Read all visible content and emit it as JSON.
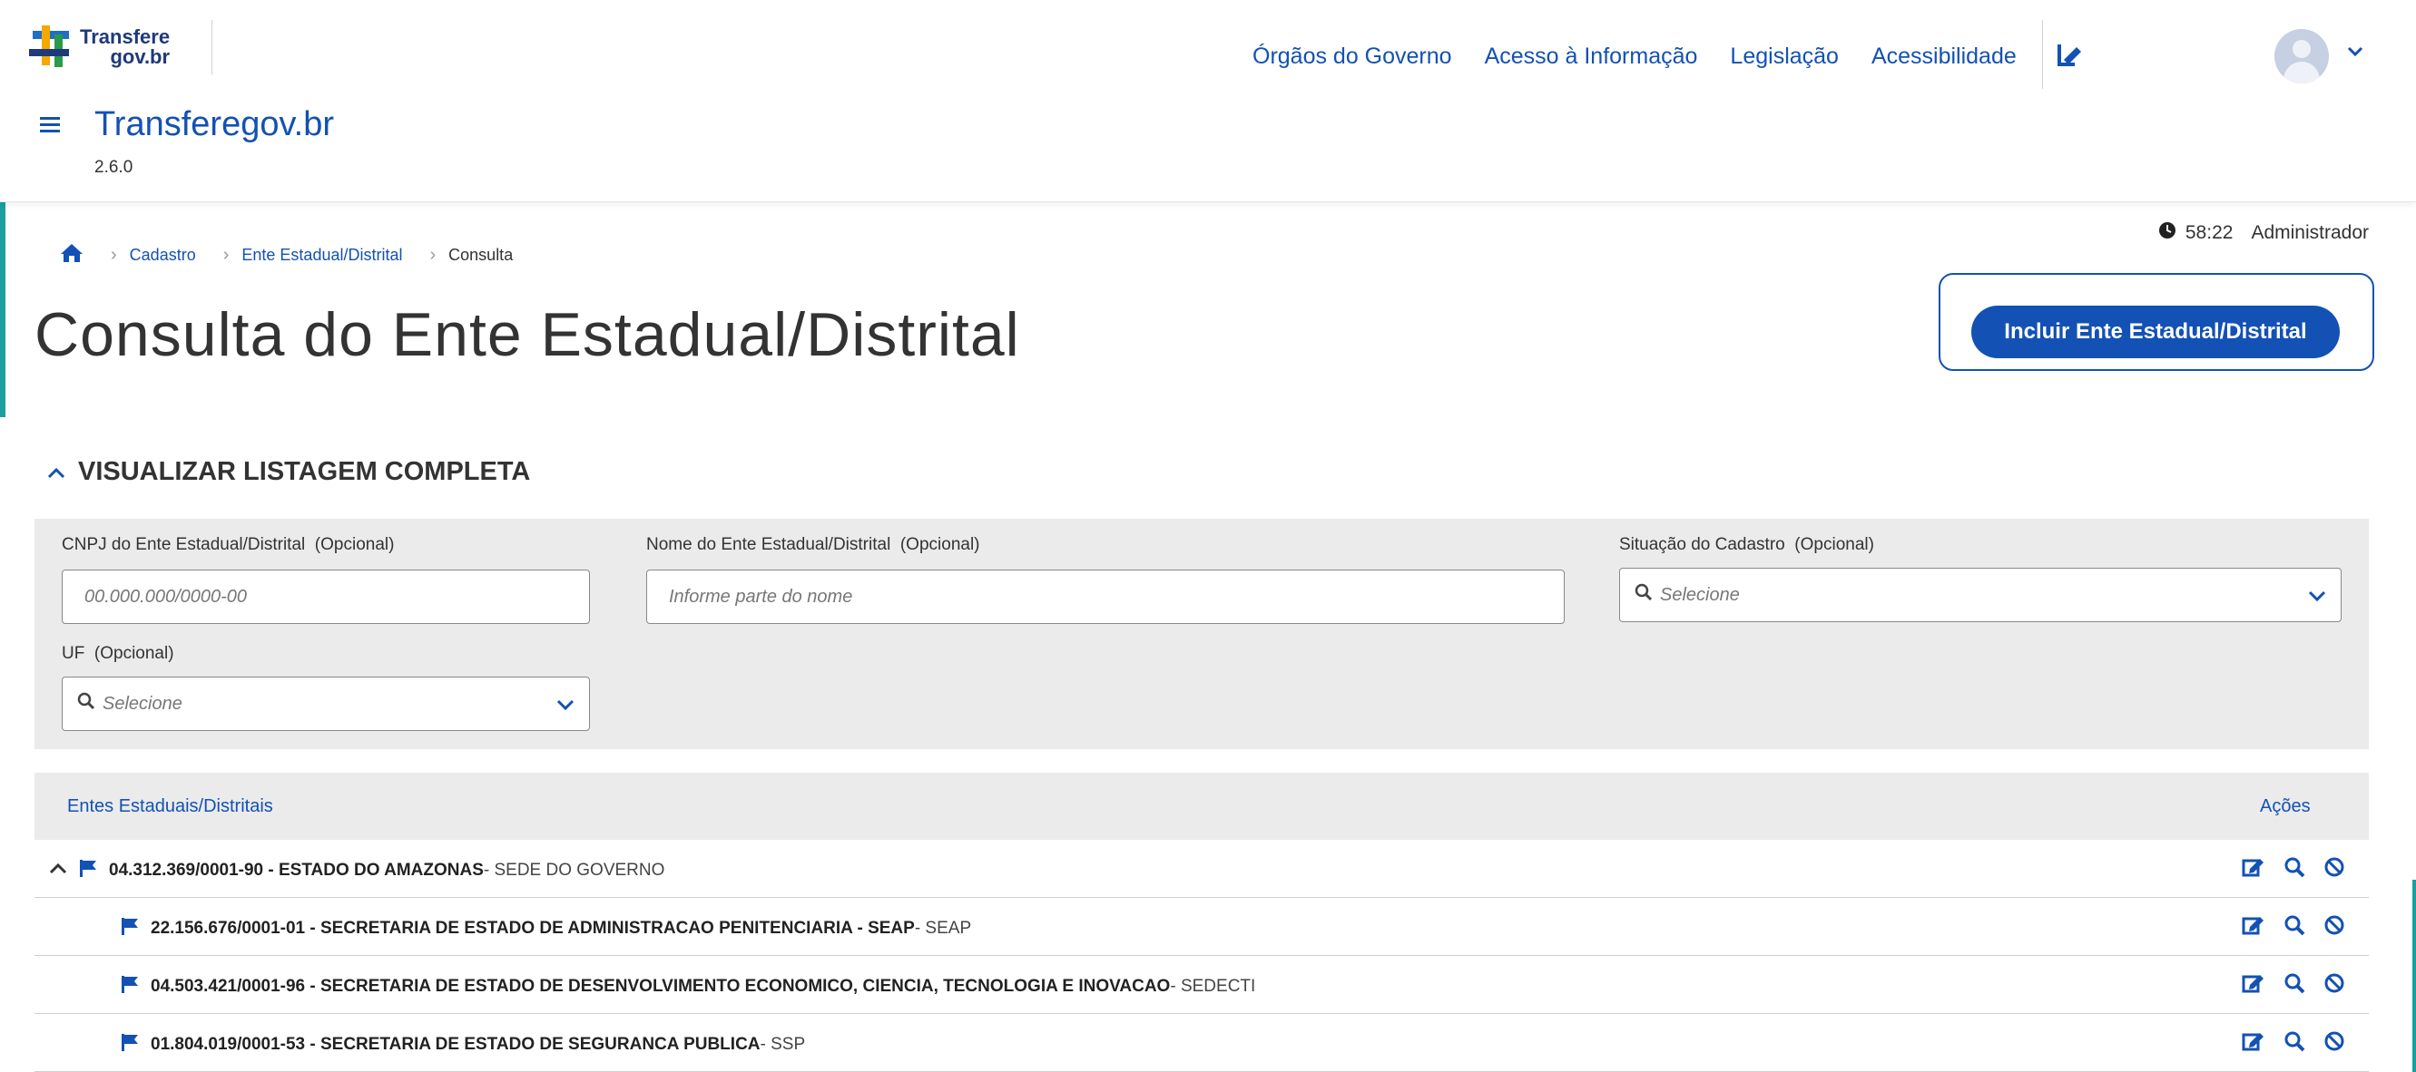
{
  "header": {
    "logo_line1": "Transfere",
    "logo_line2": "gov.br",
    "nav": [
      "Órgãos do Governo",
      "Acesso à Informação",
      "Legislação",
      "Acessibilidade"
    ],
    "system_title": "Transferegov.br",
    "version": "2.6.0"
  },
  "breadcrumb": {
    "items": [
      "Cadastro",
      "Ente Estadual/Distrital"
    ],
    "current": "Consulta"
  },
  "session": {
    "time": "58:22",
    "user": "Administrador"
  },
  "page": {
    "title": "Consulta do Ente Estadual/Distrital",
    "primary_button": "Incluir Ente Estadual/Distrital"
  },
  "filter": {
    "toggle_label": "VISUALIZAR LISTAGEM COMPLETA",
    "cnpj_label": "CNPJ do Ente Estadual/Distrital",
    "cnpj_optional": "(Opcional)",
    "cnpj_placeholder": "00.000.000/0000-00",
    "nome_label": "Nome do Ente Estadual/Distrital",
    "nome_optional": "(Opcional)",
    "nome_placeholder": "Informe parte do nome",
    "situacao_label": "Situação do Cadastro",
    "situacao_optional": "(Opcional)",
    "situacao_placeholder": "Selecione",
    "uf_label": "UF",
    "uf_optional": "(Opcional)",
    "uf_placeholder": "Selecione"
  },
  "table": {
    "col_entes": "Entes Estaduais/Distritais",
    "col_acoes": "Ações",
    "rows": [
      {
        "main": "04.312.369/0001-90 - ESTADO DO AMAZONAS",
        "suffix": " - SEDE DO GOVERNO"
      },
      {
        "main": "22.156.676/0001-01 - SECRETARIA DE ESTADO DE ADMINISTRACAO PENITENCIARIA - SEAP",
        "suffix": " - SEAP"
      },
      {
        "main": "04.503.421/0001-96 - SECRETARIA DE ESTADO DE DESENVOLVIMENTO ECONOMICO, CIENCIA, TECNOLOGIA E INOVACAO",
        "suffix": " - SEDECTI"
      },
      {
        "main": "01.804.019/0001-53 - SECRETARIA DE ESTADO DE SEGURANCA PUBLICA",
        "suffix": " - SSP"
      }
    ]
  },
  "colors": {
    "primary": "#1351b4",
    "accent_teal": "#1a9ea0",
    "panel_gray": "#ebebeb"
  },
  "icons": [
    "transferegov-logo",
    "menu-icon",
    "signature-icon",
    "avatar-icon",
    "chevron-down-icon",
    "home-icon",
    "clock-icon",
    "chevron-up-icon",
    "search-icon",
    "flag-icon",
    "edit-icon",
    "view-icon",
    "block-icon"
  ]
}
